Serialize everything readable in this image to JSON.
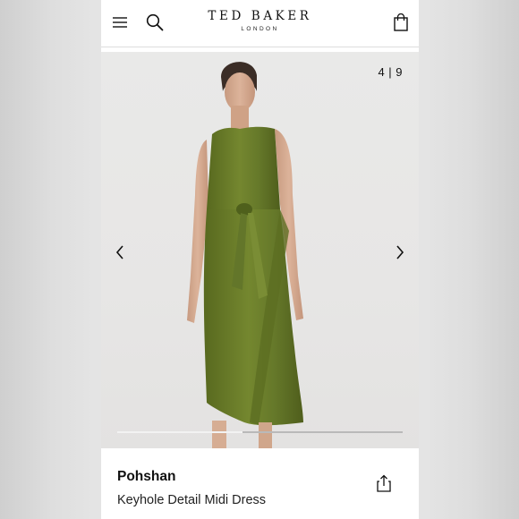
{
  "header": {
    "brand_name": "TED BAKER",
    "brand_sub": "LONDON",
    "icons": [
      "menu-icon",
      "search-icon",
      "shopping-bag-icon"
    ]
  },
  "gallery": {
    "counter": "4 | 9",
    "current_image": 4,
    "total_images": 9,
    "prev_icon": "chevron-left-icon",
    "next_icon": "chevron-right-icon",
    "progress_fraction": 0.44
  },
  "product": {
    "name": "Pohshan",
    "description": "Keyhole Detail Midi Dress",
    "share_icon": "share-icon"
  },
  "colors": {
    "dress_green": "#6a7c2c",
    "background": "#e8e7e6",
    "text": "#111111"
  }
}
